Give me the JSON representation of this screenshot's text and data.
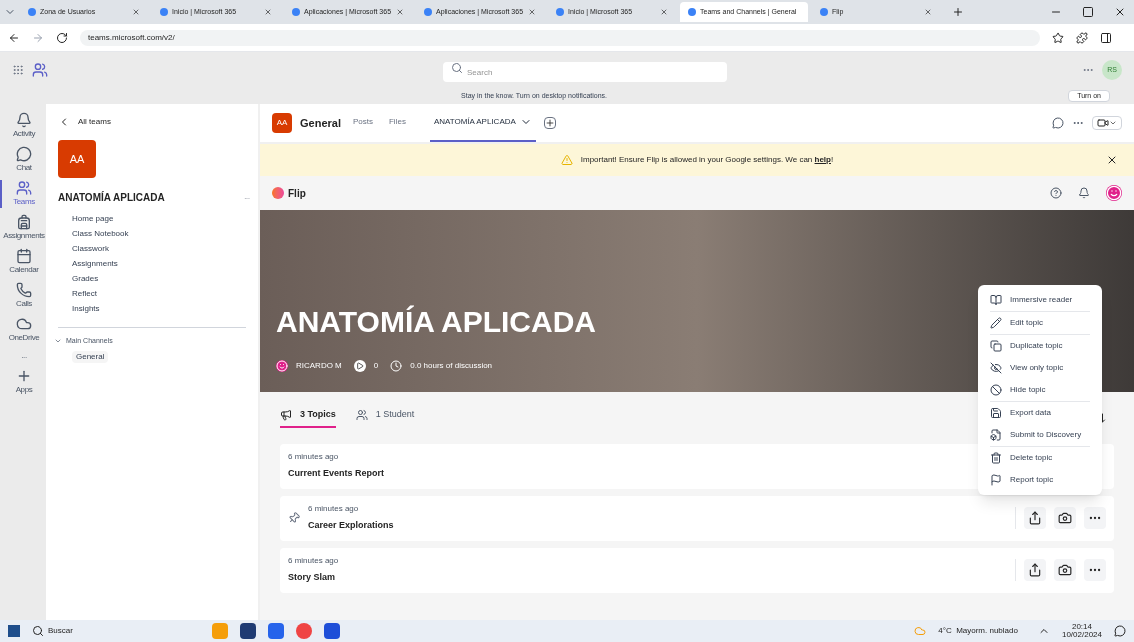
{
  "browser": {
    "tabs": [
      {
        "title": "Zona de Usuarios",
        "selected": false
      },
      {
        "title": "Inicio | Microsoft 365",
        "selected": false
      },
      {
        "title": "Aplicaciones | Microsoft 365",
        "selected": false
      },
      {
        "title": "Aplicaciones | Microsoft 365",
        "selected": false
      },
      {
        "title": "Inicio | Microsoft 365",
        "selected": false
      },
      {
        "title": "Teams and Channels | General",
        "selected": true
      },
      {
        "title": "Flip",
        "selected": false
      }
    ],
    "url": "teams.microsoft.com/v2/"
  },
  "teams_header": {
    "search_placeholder": "Search",
    "avatar": "RS"
  },
  "notification": {
    "text": "Stay in the know. Turn on desktop notifications.",
    "button": "Turn on"
  },
  "rail": [
    {
      "label": "Activity",
      "selected": false
    },
    {
      "label": "Chat",
      "selected": false
    },
    {
      "label": "Teams",
      "selected": true
    },
    {
      "label": "Assignments",
      "selected": false
    },
    {
      "label": "Calendar",
      "selected": false
    },
    {
      "label": "Calls",
      "selected": false
    },
    {
      "label": "OneDrive",
      "selected": false
    },
    {
      "label": "...",
      "selected": false
    },
    {
      "label": "Apps",
      "selected": false
    }
  ],
  "sidebar": {
    "back": "All teams",
    "team_initials": "AA",
    "team_name": "ANATOMÍA APLICADA",
    "more": "...",
    "items": [
      "Home page",
      "Class Notebook",
      "Classwork",
      "Assignments",
      "Grades",
      "Reflect",
      "Insights"
    ],
    "section": "Main Channels",
    "channels": [
      {
        "name": "General",
        "selected": true
      }
    ]
  },
  "channel_header": {
    "initials": "AA",
    "name": "General",
    "tabs": [
      {
        "label": "Posts",
        "selected": false
      },
      {
        "label": "Files",
        "selected": false
      },
      {
        "label": "ANATOMÍA APLICADA",
        "selected": true
      }
    ]
  },
  "banner": {
    "text": "Important! Ensure Flip is allowed in your Google settings. We can **help**!"
  },
  "flip": {
    "brand": "Flip",
    "hero": {
      "title": "ANATOMÍA APLICADA",
      "owner": "RICARDO M",
      "videos": "0",
      "hours": "0.0 hours of discussion"
    },
    "tabs": [
      {
        "label": "3 Topics",
        "selected": true
      },
      {
        "label": "1 Student",
        "selected": false
      }
    ],
    "topics": [
      {
        "time": "6 minutes ago",
        "title": "Current Events Report",
        "pinned": false,
        "actions": false
      },
      {
        "time": "6 minutes ago",
        "title": "Career Explorations",
        "pinned": true,
        "actions": true
      },
      {
        "time": "6 minutes ago",
        "title": "Story Slam",
        "pinned": false,
        "actions": true
      }
    ],
    "menu": [
      {
        "label": "Immersive reader",
        "kind": "reader",
        "divider": true
      },
      {
        "label": "Edit topic",
        "kind": "edit",
        "divider": true
      },
      {
        "label": "Duplicate topic",
        "kind": "duplicate",
        "divider": false
      },
      {
        "label": "View only topic",
        "kind": "viewonly",
        "divider": false
      },
      {
        "label": "Hide topic",
        "kind": "hide",
        "divider": true
      },
      {
        "label": "Export data",
        "kind": "export",
        "divider": false
      },
      {
        "label": "Submit to Discovery",
        "kind": "submit",
        "divider": true
      },
      {
        "label": "Delete topic",
        "kind": "delete",
        "divider": false
      },
      {
        "label": "Report topic",
        "kind": "report",
        "divider": false
      }
    ]
  },
  "taskbar": {
    "search": "Buscar",
    "weather": "4°C  Mayorm. nublado",
    "time": "20:14",
    "date": "10/02/2024"
  }
}
